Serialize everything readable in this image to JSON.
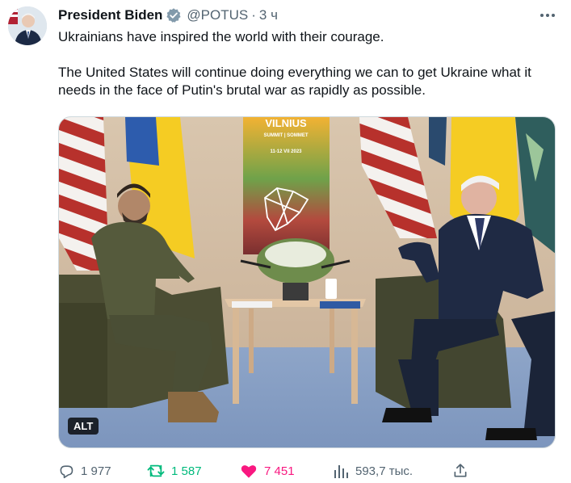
{
  "tweet": {
    "display_name": "President Biden",
    "handle": "@POTUS",
    "separator": "·",
    "time": "3 ч",
    "paragraphs": [
      "Ukrainians have inspired the world with their courage.",
      "The United States will continue doing everything we can to get Ukraine what it needs in the face of Putin's brutal war as rapidly as possible."
    ]
  },
  "media": {
    "alt_badge": "ALT",
    "sign_title": "VILNIUS",
    "sign_subtitle": "SUMMIT | SOMMET",
    "sign_date": "11-12 VII 2023"
  },
  "actions": {
    "replies": "1 977",
    "retweets": "1 587",
    "likes": "7 451",
    "views": "593,7 тыс."
  },
  "colors": {
    "retweet": "#00ba7c",
    "like": "#f91880",
    "muted": "#536471",
    "verified": "#1d9bf0"
  }
}
